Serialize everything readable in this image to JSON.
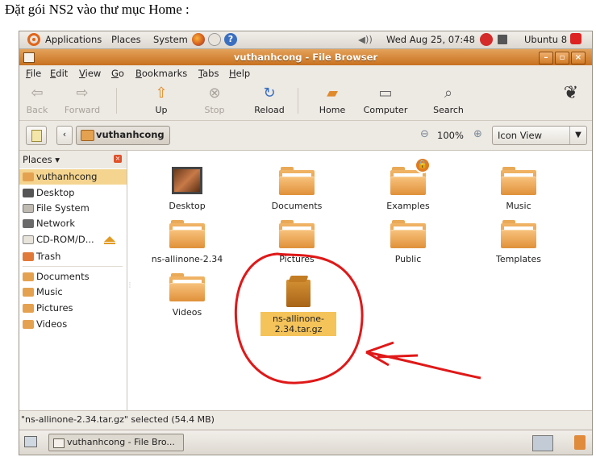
{
  "caption": "Đặt gói NS2 vào thư mục Home :",
  "top_panel": {
    "applications": "Applications",
    "places": "Places",
    "system": "System",
    "clock": "Wed Aug 25, 07:48",
    "user": "Ubuntu 8"
  },
  "window": {
    "title": "vuthanhcong - File Browser"
  },
  "menubar": [
    "File",
    "Edit",
    "View",
    "Go",
    "Bookmarks",
    "Tabs",
    "Help"
  ],
  "toolbar": {
    "back": "Back",
    "forward": "Forward",
    "up": "Up",
    "stop": "Stop",
    "reload": "Reload",
    "home": "Home",
    "computer": "Computer",
    "search": "Search"
  },
  "location": {
    "crumb": "vuthanhcong",
    "zoom": "100%",
    "view_mode": "Icon View"
  },
  "sidebar": {
    "header": "Places",
    "items": [
      "vuthanhcong",
      "Desktop",
      "File System",
      "Network",
      "CD-ROM/D...",
      "Trash",
      "Documents",
      "Music",
      "Pictures",
      "Videos"
    ]
  },
  "files": [
    "Desktop",
    "Documents",
    "Examples",
    "Music",
    "ns-allinone-2.34",
    "Pictures",
    "Public",
    "Templates",
    "Videos",
    "ns-allinone-2.34.tar.gz"
  ],
  "status": "\"ns-allinone-2.34.tar.gz\" selected (54.4 MB)",
  "taskbar": {
    "window_button": "vuthanhcong - File Bro..."
  },
  "colors": {
    "titlebar": "#d0792a",
    "selection": "#f4d48f",
    "annotation": "#e01818"
  }
}
